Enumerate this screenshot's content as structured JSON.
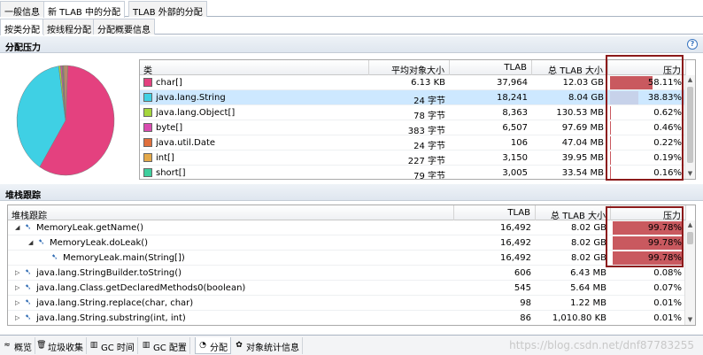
{
  "top_tabs": [
    {
      "label": "一般信息",
      "active": false
    },
    {
      "label": "新 TLAB 中的分配",
      "active": true
    },
    {
      "label": "TLAB 外部的分配",
      "active": false
    }
  ],
  "sub_tabs": [
    {
      "label": "按类分配",
      "active": true
    },
    {
      "label": "按线程分配",
      "active": false
    },
    {
      "label": "分配概要信息",
      "active": false
    }
  ],
  "alloc_section": {
    "title": "分配压力",
    "help": "?"
  },
  "class_table": {
    "headers": [
      "类",
      "平均对象大小",
      "TLAB",
      "总 TLAB 大小",
      "压力"
    ],
    "rows": [
      {
        "name": "char[]",
        "avg": "6.13 KB",
        "tlab": "37,964",
        "total": "12.03 GB",
        "pressure": "58.11%",
        "pct": 58.11,
        "color": "#e4417f",
        "bar_color": "#c9595f"
      },
      {
        "name": "java.lang.String",
        "avg": "24 字节",
        "tlab": "18,241",
        "total": "8.04 GB",
        "pressure": "38.83%",
        "pct": 38.83,
        "color": "#3fd0e4",
        "bar_color": "#c7d2ea",
        "selected": true
      },
      {
        "name": "java.lang.Object[]",
        "avg": "78 字节",
        "tlab": "8,363",
        "total": "130.53 MB",
        "pressure": "0.62%",
        "pct": 0.62,
        "color": "#a5d63c",
        "bar_color": "#c9595f"
      },
      {
        "name": "byte[]",
        "avg": "383 字节",
        "tlab": "6,507",
        "total": "97.69 MB",
        "pressure": "0.46%",
        "pct": 0.46,
        "color": "#d94cb0",
        "bar_color": "#c9595f"
      },
      {
        "name": "java.util.Date",
        "avg": "24 字节",
        "tlab": "106",
        "total": "47.04 MB",
        "pressure": "0.22%",
        "pct": 0.22,
        "color": "#e0703c",
        "bar_color": "#c9595f"
      },
      {
        "name": "int[]",
        "avg": "227 字节",
        "tlab": "3,150",
        "total": "39.95 MB",
        "pressure": "0.19%",
        "pct": 0.19,
        "color": "#e4a94a",
        "bar_color": "#c9595f"
      },
      {
        "name": "short[]",
        "avg": "79 字节",
        "tlab": "3,005",
        "total": "33.54 MB",
        "pressure": "0.16%",
        "pct": 0.16,
        "color": "#3fcf9e",
        "bar_color": "#c9595f"
      }
    ]
  },
  "stack_section": {
    "title": "堆栈跟踪"
  },
  "stack_table": {
    "headers": [
      "堆栈跟踪",
      "TLAB",
      "总 TLAB 大小",
      "压力"
    ],
    "rows": [
      {
        "depth": 0,
        "expander": "◢",
        "name": "MemoryLeak.getName()",
        "tlab": "16,492",
        "total": "8.02 GB",
        "pressure": "99.78%",
        "pct": 99.78
      },
      {
        "depth": 1,
        "expander": "◢",
        "name": "MemoryLeak.doLeak()",
        "tlab": "16,492",
        "total": "8.02 GB",
        "pressure": "99.78%",
        "pct": 99.78
      },
      {
        "depth": 2,
        "expander": "",
        "name": "MemoryLeak.main(String[])",
        "tlab": "16,492",
        "total": "8.02 GB",
        "pressure": "99.78%",
        "pct": 99.78
      },
      {
        "depth": 0,
        "expander": "▷",
        "name": "java.lang.StringBuilder.toString()",
        "tlab": "606",
        "total": "6.43 MB",
        "pressure": "0.08%",
        "pct": 0.08
      },
      {
        "depth": 0,
        "expander": "▷",
        "name": "java.lang.Class.getDeclaredMethods0(boolean)",
        "tlab": "545",
        "total": "5.64 MB",
        "pressure": "0.07%",
        "pct": 0.07
      },
      {
        "depth": 0,
        "expander": "▷",
        "name": "java.lang.String.replace(char, char)",
        "tlab": "98",
        "total": "1.22 MB",
        "pressure": "0.01%",
        "pct": 0.01
      },
      {
        "depth": 0,
        "expander": "▷",
        "name": "java.lang.String.substring(int, int)",
        "tlab": "86",
        "total": "1,010.80 KB",
        "pressure": "0.01%",
        "pct": 0.01
      }
    ]
  },
  "bottom_tabs": [
    {
      "label": "概览",
      "icon": "overview-icon",
      "glyph": "≈",
      "active": false
    },
    {
      "label": "垃圾收集",
      "icon": "trash-icon",
      "glyph": "🗑",
      "active": false
    },
    {
      "label": "GC 时间",
      "icon": "gc-time-icon",
      "glyph": "▥",
      "active": false
    },
    {
      "label": "GC 配置",
      "icon": "gc-config-icon",
      "glyph": "▥",
      "active": false
    },
    {
      "label": "分配",
      "icon": "allocation-icon",
      "glyph": "◔",
      "active": true
    },
    {
      "label": "对象统计信息",
      "icon": "object-stats-icon",
      "glyph": "✿",
      "active": false
    }
  ],
  "watermark": "https://blog.csdn.net/dnf87783255",
  "pie_slices": [
    {
      "pct": 58.11,
      "color": "#e4417f"
    },
    {
      "pct": 38.83,
      "color": "#3fd0e4"
    },
    {
      "pct": 0.62,
      "color": "#a5d63c"
    },
    {
      "pct": 0.46,
      "color": "#d94cb0"
    },
    {
      "pct": 0.22,
      "color": "#e0703c"
    },
    {
      "pct": 0.19,
      "color": "#e4a94a"
    },
    {
      "pct": 0.16,
      "color": "#3fcf9e"
    },
    {
      "pct": 1.41,
      "color": "#b58a6a"
    }
  ],
  "colors": {
    "highlight_border": "#8b1a1a",
    "pressure_bar": "#c9595f",
    "selection": "#cde8ff"
  }
}
